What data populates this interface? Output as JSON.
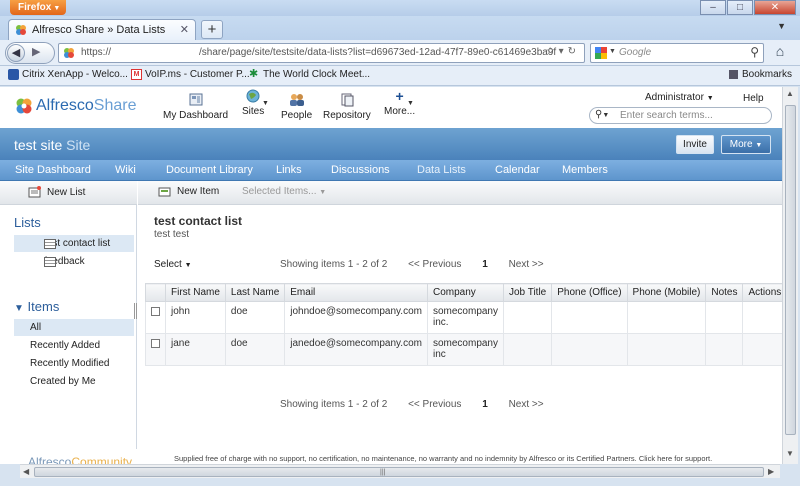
{
  "browser": {
    "menu_button": "Firefox",
    "tab_title": "Alfresco Share » Data Lists",
    "url_scheme": "https://",
    "url_path": "/share/page/site/testsite/data-lists?list=d69673ed-12ad-47f7-89e0-c61469e3ba9f",
    "search_placeholder": "Google",
    "bookmarks": [
      {
        "label": "Citrix XenApp - Welco..."
      },
      {
        "label": "VoIP.ms - Customer P..."
      },
      {
        "label": "The World Clock Meet..."
      }
    ],
    "bookmarks_menu": "Bookmarks"
  },
  "app": {
    "logo_main": "Alfresco",
    "logo_sub": "Share",
    "nav": {
      "dashboard": "My Dashboard",
      "sites": "Sites",
      "people": "People",
      "repository": "Repository",
      "more": "More..."
    },
    "user": "Administrator",
    "help": "Help",
    "search_placeholder": "Enter search terms..."
  },
  "site": {
    "name": "test site",
    "suffix": "Site",
    "invite": "Invite",
    "more": "More",
    "nav": [
      "Site Dashboard",
      "Wiki",
      "Document Library",
      "Links",
      "Discussions",
      "Data Lists",
      "Calendar",
      "Members"
    ]
  },
  "sidebar": {
    "new_list": "New List",
    "lists_heading": "Lists",
    "lists": [
      {
        "label": "test contact list"
      },
      {
        "label": "feedback"
      }
    ],
    "items_heading": "Items",
    "filters": [
      {
        "label": "All"
      },
      {
        "label": "Recently Added"
      },
      {
        "label": "Recently Modified"
      },
      {
        "label": "Created by Me"
      }
    ]
  },
  "main": {
    "new_item": "New Item",
    "selected_items": "Selected Items...",
    "list_title": "test contact list",
    "list_description": "test test",
    "select_menu": "Select",
    "pager": {
      "info": "Showing items 1 - 2 of 2",
      "previous": "<< Previous",
      "page": "1",
      "next": "Next >>"
    },
    "columns": [
      "First Name",
      "Last Name",
      "Email",
      "Company",
      "Job Title",
      "Phone (Office)",
      "Phone (Mobile)",
      "Notes",
      "Actions"
    ],
    "rows": [
      {
        "first": "john",
        "last": "doe",
        "email": "johndoe@somecompany.com",
        "company_line1": "somecompany",
        "company_line2": "inc."
      },
      {
        "first": "jane",
        "last": "doe",
        "email": "janedoe@somecompany.com",
        "company_line1": "somecompany",
        "company_line2": "inc"
      }
    ]
  },
  "footer": {
    "logo_main": "Alfresco",
    "logo_community": "Community",
    "text": "Supplied free of charge with no support, no certification, no maintenance, no warranty and no indemnity by Alfresco or its Certified Partners. Click here for support."
  },
  "colors": {
    "site_bar": "#4a82bb",
    "site_nav": "#6ea3d1",
    "heading": "#2c5e9b",
    "selection": "#dce8f4"
  }
}
